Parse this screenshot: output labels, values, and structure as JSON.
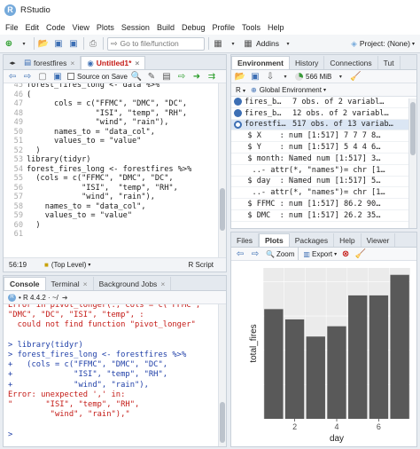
{
  "window": {
    "title": "RStudio"
  },
  "menu": [
    "File",
    "Edit",
    "Code",
    "View",
    "Plots",
    "Session",
    "Build",
    "Debug",
    "Profile",
    "Tools",
    "Help"
  ],
  "toolbar": {
    "goto_placeholder": "Go to file/function",
    "addins": "Addins",
    "project": "Project: (None)"
  },
  "editor": {
    "tabs": [
      "forestfires",
      "Untitled1*"
    ],
    "source_on_save": "Source on Save",
    "run": "Run",
    "source": "Source",
    "status": {
      "pos": "56:19",
      "level": "(Top Level)",
      "type": "R Script"
    },
    "line_numbers": [
      "45",
      "46",
      "47",
      "48",
      "49",
      "50",
      "51",
      "52",
      "53",
      "54",
      "55",
      "56",
      "57",
      "58",
      "59",
      "60",
      "61"
    ],
    "lines": [
      "forest_fires_long <- data %>%",
      "(",
      "      cols = c(\"FFMC\", \"DMC\", \"DC\",",
      "               \"ISI\", \"temp\", \"RH\",",
      "               \"wind\", \"rain\"),",
      "      names_to = \"data_col\",",
      "      values_to = \"value\"",
      "  )",
      "library(tidyr)",
      "forest_fires_long <- forestfires %>%",
      "  (cols = c(\"FFMC\", \"DMC\", \"DC\",",
      "            \"ISI\",  \"temp\", \"RH\",",
      "            \"wind\", \"rain\"),",
      "    names_to = \"data_col\",",
      "    values_to = \"value\"",
      "  )",
      ""
    ]
  },
  "console": {
    "tabs": [
      "Console",
      "Terminal",
      "Background Jobs"
    ],
    "version": "R 4.4.2",
    "path": "~/",
    "lines": [
      {
        "t": "Error in pivot_longer(., cols = c(\"FFMC\",",
        "c": "red"
      },
      {
        "t": "\"DMC\", \"DC\", \"ISI\", \"temp\", :",
        "c": "red"
      },
      {
        "t": "  could not find function \"pivot_longer\"",
        "c": "red"
      },
      {
        "t": "",
        "c": "blue"
      },
      {
        "t": "> library(tidyr)",
        "c": "blue"
      },
      {
        "t": "> forest_fires_long <- forestfires %>%",
        "c": "blue"
      },
      {
        "t": "+   (cols = c(\"FFMC\", \"DMC\", \"DC\",",
        "c": "blue"
      },
      {
        "t": "+             \"ISI\", \"temp\", \"RH\",",
        "c": "blue"
      },
      {
        "t": "+             \"wind\", \"rain\"),",
        "c": "blue"
      },
      {
        "t": "Error: unexpected ',' in:",
        "c": "red"
      },
      {
        "t": "\"       \"ISI\", \"temp\", \"RH\",",
        "c": "red"
      },
      {
        "t": "         \"wind\", \"rain\"),\"",
        "c": "red"
      },
      {
        "t": "",
        "c": "blue"
      },
      {
        "t": ">",
        "c": "blue"
      }
    ]
  },
  "environment": {
    "tabs": [
      "Environment",
      "History",
      "Connections",
      "Tut"
    ],
    "memory": "566 MiB",
    "scope": "Global Environment",
    "rows": [
      {
        "name": "fires_b…",
        "value": "7 obs. of 2 variabl…",
        "icon": "blue-circle"
      },
      {
        "name": "fires_b…",
        "value": "12 obs. of 2 variabl…",
        "icon": "blue-circle"
      },
      {
        "name": "forestfi…",
        "value": "517 obs. of 13 variab…",
        "icon": "blue-circle-open"
      },
      {
        "name": "",
        "value": "  $ X    : num [1:517] 7 7 7 8…",
        "icon": ""
      },
      {
        "name": "",
        "value": "  $ Y    : num [1:517] 5 4 4 6…",
        "icon": ""
      },
      {
        "name": "",
        "value": "  $ month: Named num [1:517] 3…",
        "icon": ""
      },
      {
        "name": "",
        "value": "   ..- attr(*, \"names\")= chr [1…",
        "icon": ""
      },
      {
        "name": "",
        "value": "  $ day  : Named num [1:517] 5…",
        "icon": ""
      },
      {
        "name": "",
        "value": "   ..- attr(*, \"names\")= chr [1…",
        "icon": ""
      },
      {
        "name": "",
        "value": "  $ FFMC : num [1:517] 86.2 90…",
        "icon": ""
      },
      {
        "name": "",
        "value": "  $ DMC  : num [1:517] 26.2 35…",
        "icon": ""
      }
    ]
  },
  "plots": {
    "tabs": [
      "Files",
      "Plots",
      "Packages",
      "Help",
      "Viewer"
    ],
    "zoom": "Zoom",
    "export": "Export",
    "bar_color": "#595959",
    "chart_data": {
      "type": "bar",
      "categories": [
        1,
        2,
        3,
        4,
        5,
        6,
        7
      ],
      "values": [
        32,
        29,
        24,
        27,
        36,
        36,
        42
      ],
      "ylabel": "total_fires",
      "xlabel": "day",
      "xticks": [
        "2",
        "4",
        "6"
      ],
      "ylim": [
        0,
        44
      ],
      "grid": true
    }
  }
}
